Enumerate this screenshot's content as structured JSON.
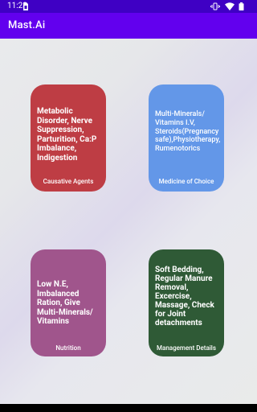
{
  "status_bar": {
    "time": "11:28",
    "icons": [
      "sim-card-icon",
      "vibrate-icon",
      "wifi-icon",
      "battery-icon"
    ]
  },
  "app_bar": {
    "title": "Mast.Ai"
  },
  "cards": {
    "causative": {
      "text": "Metabolic Disorder, Nerve Suppression, Parturition, Ca:P Imbalance, Indigestion",
      "caption": "Causative Agents",
      "color": "#be3d44"
    },
    "medicine": {
      "text": "Multi-Minerals/ Vitamins I.V, Steroids(Pregnancy safe),Physiotherapy, Rumenotorics",
      "caption": "Medicine of Choice",
      "color": "#6397e8"
    },
    "nutrition": {
      "text": "Low N.E, Imbalanced Ration, Give Multi-Minerals/ Vitamins",
      "caption": "Nutrition",
      "color": "#a0558c"
    },
    "management": {
      "text": "Soft Bedding, Regular Manure Removal, Excercise, Massage, Check for Joint detachments",
      "caption": "Management Details",
      "color": "#2f5a36"
    }
  },
  "colors": {
    "status_bar": "#3f00c4",
    "app_bar": "#6200ee"
  }
}
